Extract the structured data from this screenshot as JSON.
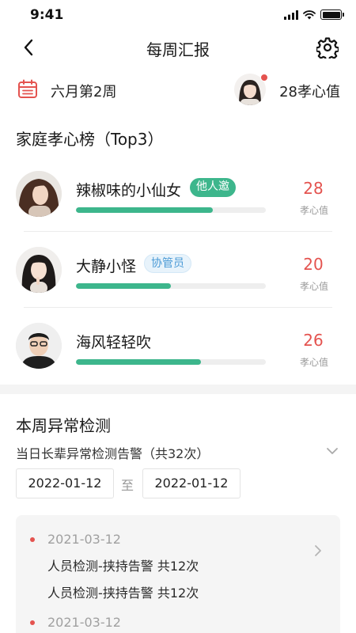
{
  "status_bar": {
    "time": "9:41"
  },
  "nav": {
    "title": "每周汇报",
    "back_icon": "chevron-left-icon",
    "settings_icon": "gear-icon"
  },
  "week": {
    "label": "六月第2周",
    "score": "28孝心值"
  },
  "ranking": {
    "title": "家庭孝心榜（Top3）",
    "unit": "孝心值",
    "items": [
      {
        "name": "辣椒味的小仙女",
        "tag": "他人邀",
        "tag_style": "green",
        "score": "28",
        "progress": 0.72
      },
      {
        "name": "大静小怪",
        "tag": "协管员",
        "tag_style": "blue",
        "score": "20",
        "progress": 0.5
      },
      {
        "name": "海风轻轻吹",
        "tag": "",
        "tag_style": "",
        "score": "26",
        "progress": 0.66
      }
    ]
  },
  "detection": {
    "title": "本周异常检测",
    "subtitle": "当日长辈异常检测告警（共32次）",
    "date_from": "2022-01-12",
    "date_sep": "至",
    "date_to": "2022-01-12",
    "records": [
      {
        "date": "2021-03-12",
        "lines": [
          "人员检测-挟持告警  共12次",
          "人员检测-挟持告警  共12次"
        ]
      },
      {
        "date": "2021-03-12",
        "lines": []
      }
    ]
  },
  "colors": {
    "accent_green": "#3db68c",
    "score_red": "#e4534f",
    "tag_blue": "#4a9ad6"
  }
}
